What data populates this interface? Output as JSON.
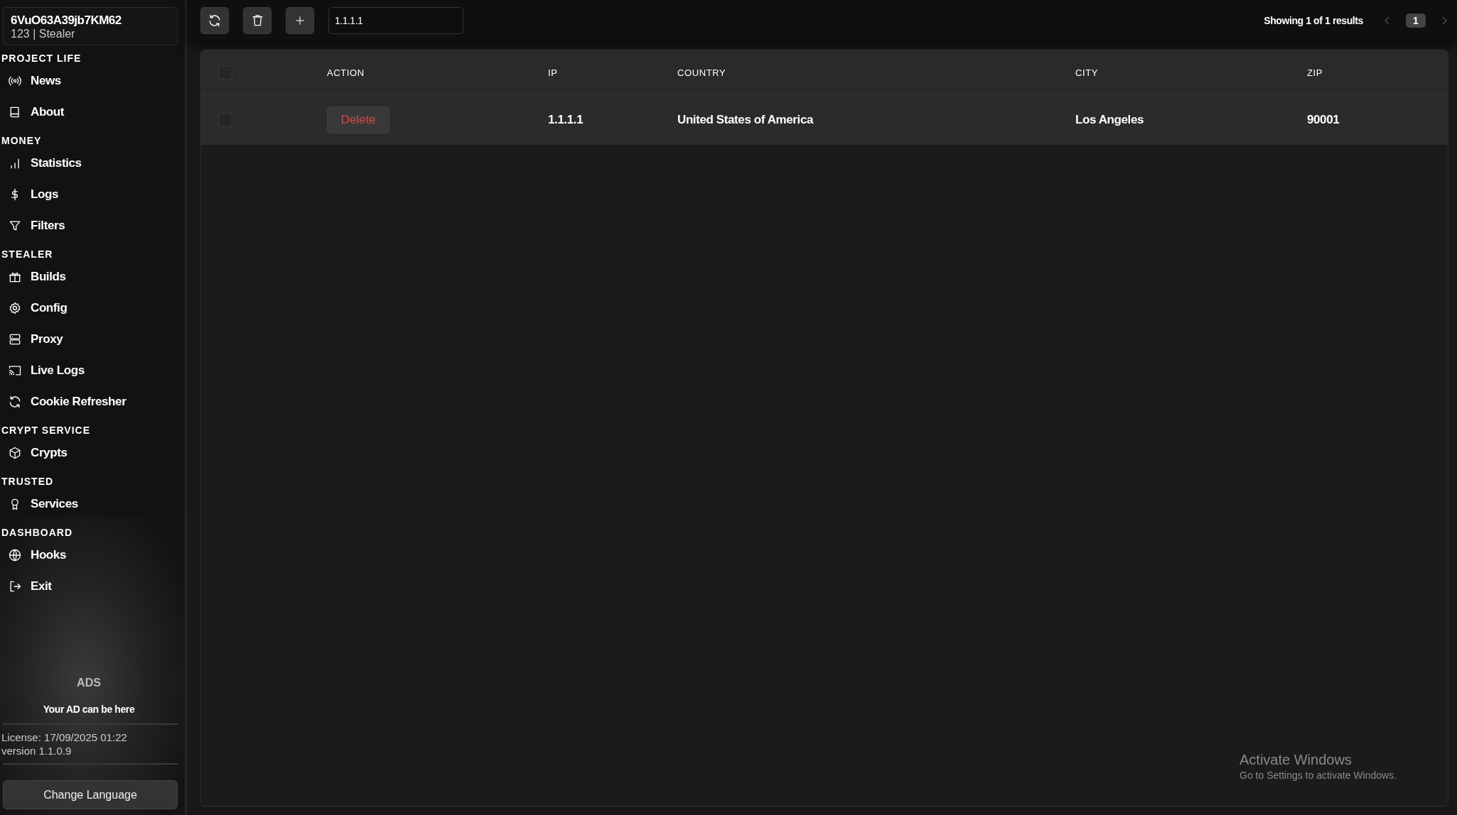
{
  "account": {
    "id": "6VuO63A39jb7KM62",
    "subtitle": "123 | Stealer"
  },
  "sidebar": {
    "sections": [
      {
        "title": "PROJECT LIFE",
        "items": [
          {
            "label": "News"
          },
          {
            "label": "About"
          }
        ]
      },
      {
        "title": "MONEY",
        "items": [
          {
            "label": "Statistics"
          },
          {
            "label": "Logs"
          },
          {
            "label": "Filters"
          }
        ]
      },
      {
        "title": "STEALER",
        "items": [
          {
            "label": "Builds"
          },
          {
            "label": "Config"
          },
          {
            "label": "Proxy"
          },
          {
            "label": "Live Logs"
          },
          {
            "label": "Cookie Refresher"
          }
        ]
      },
      {
        "title": "CRYPT SERVICE",
        "items": [
          {
            "label": "Crypts"
          }
        ]
      },
      {
        "title": "TRUSTED",
        "items": [
          {
            "label": "Services"
          }
        ]
      },
      {
        "title": "DASHBOARD",
        "items": [
          {
            "label": "Hooks"
          },
          {
            "label": "Exit"
          }
        ]
      }
    ]
  },
  "ads": {
    "title": "ADS",
    "text": "Your AD can be here"
  },
  "license": "License: 17/09/2025 01:22",
  "version": "version 1.1.0.9",
  "language_button": "Change Language",
  "toolbar": {
    "search": {
      "value": "1.1.1.1"
    },
    "summary": "Showing 1 of 1 results",
    "pages": [
      {
        "label": "1",
        "selected": true
      }
    ]
  },
  "table": {
    "all_checked": false,
    "columns": [
      "ACTION",
      "IP",
      "COUNTRY",
      "CITY",
      "ZIP"
    ],
    "rows": [
      {
        "checked": false,
        "cells": [
          "Delete",
          "1.1.1.1",
          "United States of America",
          "Los Angeles",
          "90001"
        ]
      }
    ]
  },
  "os_notice": {
    "title": "Activate Windows",
    "text": "Go to Settings to activate Windows."
  }
}
